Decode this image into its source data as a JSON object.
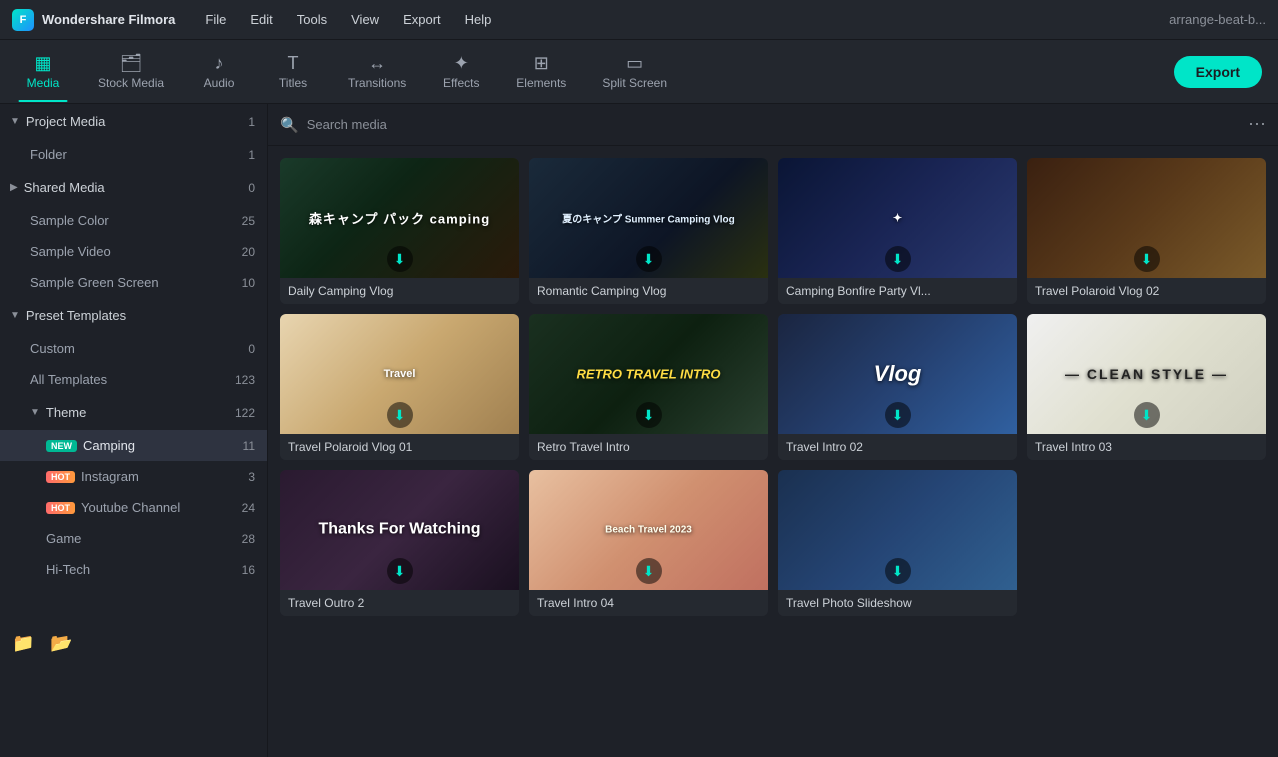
{
  "app": {
    "name": "Wondershare Filmora",
    "user": "arrange-beat-b..."
  },
  "menu": {
    "items": [
      "File",
      "Edit",
      "Tools",
      "View",
      "Export",
      "Help"
    ]
  },
  "toolbar": {
    "items": [
      {
        "id": "media",
        "label": "Media",
        "icon": "▦",
        "active": true
      },
      {
        "id": "stock-media",
        "label": "Stock Media",
        "icon": "🗂"
      },
      {
        "id": "audio",
        "label": "Audio",
        "icon": "♪"
      },
      {
        "id": "titles",
        "label": "Titles",
        "icon": "T"
      },
      {
        "id": "transitions",
        "label": "Transitions",
        "icon": "↔"
      },
      {
        "id": "effects",
        "label": "Effects",
        "icon": "✦"
      },
      {
        "id": "elements",
        "label": "Elements",
        "icon": "⊞"
      },
      {
        "id": "split-screen",
        "label": "Split Screen",
        "icon": "▭"
      }
    ],
    "export_label": "Export"
  },
  "sidebar": {
    "project_media": {
      "label": "Project Media",
      "count": 1,
      "expanded": true
    },
    "folder": {
      "label": "Folder",
      "count": 1
    },
    "shared_media": {
      "label": "Shared Media",
      "count": 0,
      "expanded": false
    },
    "sample_color": {
      "label": "Sample Color",
      "count": 25
    },
    "sample_video": {
      "label": "Sample Video",
      "count": 20
    },
    "sample_green_screen": {
      "label": "Sample Green Screen",
      "count": 10
    },
    "preset_templates": {
      "label": "Preset Templates",
      "count": null,
      "expanded": true
    },
    "custom": {
      "label": "Custom",
      "count": 0
    },
    "all_templates": {
      "label": "All Templates",
      "count": 123
    },
    "theme": {
      "label": "Theme",
      "count": 122,
      "expanded": true
    },
    "camping": {
      "label": "Camping",
      "count": 11,
      "badge": "New"
    },
    "instagram": {
      "label": "Instagram",
      "count": 3,
      "badge": "Hot"
    },
    "youtube_channel": {
      "label": "Youtube Channel",
      "count": 24,
      "badge": "Hot"
    },
    "game": {
      "label": "Game",
      "count": 28
    },
    "hi_tech": {
      "label": "Hi-Tech",
      "count": 16
    }
  },
  "search": {
    "placeholder": "Search media"
  },
  "media_items": [
    {
      "id": 1,
      "label": "Daily Camping Vlog",
      "thumb_class": "thumb-1",
      "thumb_text": "森キャンプ パック\ncamping",
      "thumb_style": "japanese"
    },
    {
      "id": 2,
      "label": "Romantic Camping Vlog",
      "thumb_class": "thumb-2",
      "thumb_text": "夏のキャンプ\nSummer Camping Vlog",
      "thumb_style": "camping-bg"
    },
    {
      "id": 3,
      "label": "Camping Bonfire Party Vl...",
      "thumb_class": "thumb-3",
      "thumb_text": "✦",
      "thumb_style": ""
    },
    {
      "id": 4,
      "label": "Travel Polaroid Vlog 02",
      "thumb_class": "thumb-4",
      "thumb_text": "",
      "thumb_style": ""
    },
    {
      "id": 5,
      "label": "Travel Polaroid Vlog 01",
      "thumb_class": "thumb-5",
      "thumb_text": "Travel",
      "thumb_style": ""
    },
    {
      "id": 6,
      "label": "Retro Travel Intro",
      "thumb_class": "thumb-6",
      "thumb_text": "RETRO\nTRAVEL\nINTRO",
      "thumb_style": "retro"
    },
    {
      "id": 7,
      "label": "Travel Intro 02",
      "thumb_class": "thumb-7",
      "thumb_text": "Vlog",
      "thumb_style": "vlog"
    },
    {
      "id": 8,
      "label": "Travel Intro 03",
      "thumb_class": "thumb-8",
      "thumb_text": "— CLEAN STYLE —",
      "thumb_style": "clean"
    },
    {
      "id": 9,
      "label": "Travel Outro 2",
      "thumb_class": "thumb-9",
      "thumb_text": "Thanks\nFor Watching",
      "thumb_style": "thanks"
    },
    {
      "id": 10,
      "label": "Travel Intro 04",
      "thumb_class": "thumb-10",
      "thumb_text": "Beach Travel 2023",
      "thumb_style": "beach"
    },
    {
      "id": 11,
      "label": "Travel Photo Slideshow",
      "thumb_class": "thumb-11",
      "thumb_text": "",
      "thumb_style": "photo-slide"
    }
  ]
}
